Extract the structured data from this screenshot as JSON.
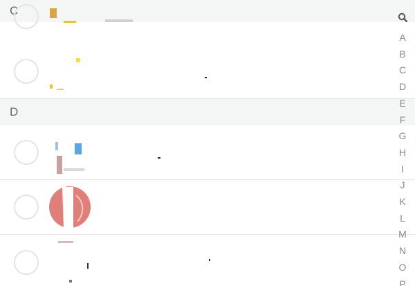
{
  "sections": [
    {
      "letter": "C"
    },
    {
      "letter": "D"
    }
  ],
  "index_bar": {
    "search_icon": "search-icon",
    "letters": [
      "A",
      "B",
      "C",
      "D",
      "E",
      "F",
      "G",
      "H",
      "I",
      "J",
      "K",
      "L",
      "M",
      "N",
      "O",
      "P"
    ]
  },
  "colors": {
    "section_background": "#f4f5f5",
    "divider": "#e6e6e6",
    "radio_border": "#e4e4e4",
    "index_text": "#8a8a8a"
  }
}
